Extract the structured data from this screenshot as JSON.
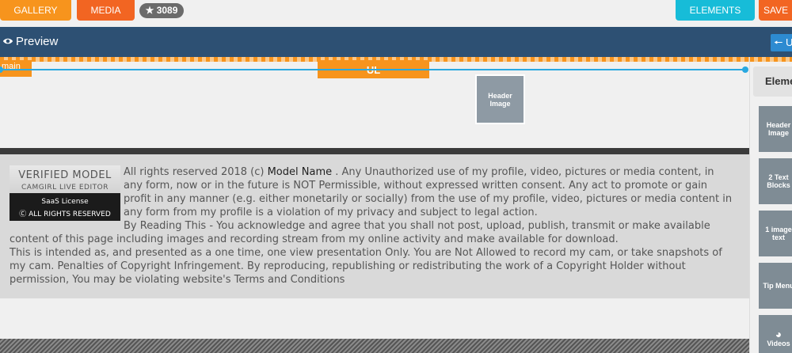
{
  "toolbar": {
    "gallery_label": "GALLERY",
    "media_label": "MEDIA",
    "star_count": "3089",
    "elements_label": "ELEMENTS",
    "save_label": "SAVE"
  },
  "preview": {
    "title": "Preview",
    "undo_label": "U"
  },
  "canvas": {
    "main_tag": "main",
    "ul_tag": "UL",
    "header_image_label": "Header Image"
  },
  "footer": {
    "logo_line1": "VERIFIED MODEL",
    "logo_line2": "CAMGIRL LIVE EDITOR",
    "logo_line3": "SaaS License",
    "logo_line4": "ALL RIGHTS RESERVED",
    "text_1": "All rights reserved 2018 (c) ",
    "model_name": "Model Name",
    "text_2": " . Any Unauthorized use of my profile, video, pictures or media content, in any form, now or in the future is NOT Permissible, without expressed written consent. Any act to promote or gain profit in any manner (e.g. either monetarily or socially) from the use of my profile, video, pictures or media content in any form from my profile is a violation of my privacy and subject to legal action.",
    "text_3": "By Reading This - You acknowledge and agree that you shall not post, upload, publish, transmit or make available content of this page including images and recording stream from my online activity and make available for download.",
    "text_4": "This is intended as, and presented as a one time, one view presentation Only. You are Not Allowed to record my cam, or take snapshots of my cam. Penalties of Copyright Infringement. By reproducing, republishing or redistributing the work of a Copyright Holder without permission, You may be violating website's Terms and Conditions"
  },
  "sidebar": {
    "heading": "Elements",
    "items": [
      {
        "label": "Header Image"
      },
      {
        "label": "2 Text Blocks"
      },
      {
        "label": "1 image text"
      },
      {
        "label": "Tip Menu"
      },
      {
        "label": "Videos"
      }
    ]
  },
  "colors": {
    "orange": "#f7941d",
    "red_orange": "#f26522",
    "cyan": "#17bcd8",
    "navy": "#2d5073",
    "select_blue": "#29a8e0"
  }
}
